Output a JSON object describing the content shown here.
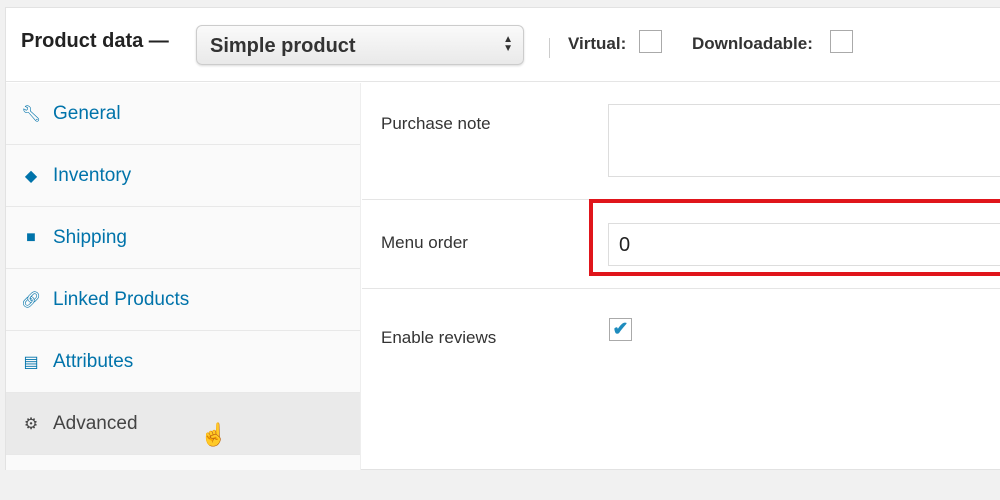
{
  "header": {
    "title": "Product data —",
    "product_type": "Simple product",
    "virtual_label": "Virtual:",
    "virtual_checked": false,
    "downloadable_label": "Downloadable:",
    "downloadable_checked": false
  },
  "sidebar": {
    "items": [
      {
        "label": "General",
        "icon": "wrench-icon"
      },
      {
        "label": "Inventory",
        "icon": "tag-icon"
      },
      {
        "label": "Shipping",
        "icon": "truck-icon"
      },
      {
        "label": "Linked Products",
        "icon": "link-icon"
      },
      {
        "label": "Attributes",
        "icon": "list-icon"
      },
      {
        "label": "Advanced",
        "icon": "gear-icon",
        "active": true
      }
    ]
  },
  "fields": {
    "purchase_note_label": "Purchase note",
    "purchase_note_value": "",
    "menu_order_label": "Menu order",
    "menu_order_value": "0",
    "enable_reviews_label": "Enable reviews",
    "enable_reviews_checked": true,
    "check_glyph": "✔"
  },
  "colors": {
    "link": "#0073aa",
    "highlight": "#e0151b"
  }
}
